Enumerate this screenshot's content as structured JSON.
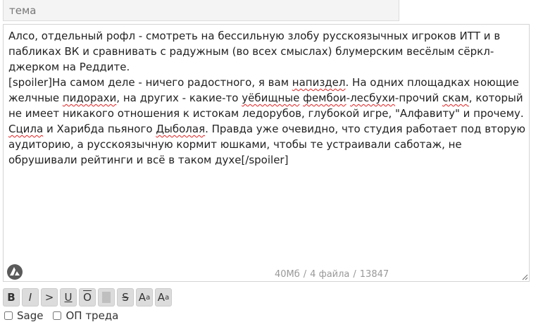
{
  "subject": {
    "placeholder": "тема",
    "value": ""
  },
  "message": {
    "segments": [
      {
        "text": "Алсо, отдельный рофл - смотреть на бессильную злобу русскоязычных игроков ИТТ и в пабликах ВК и сравнивать с радужным (во всех смыслах) блумерским весёлым сёркл-джерком на Реддите.\n[spoiler]На самом деле - ничего радостного, я вам ",
        "flag": false
      },
      {
        "text": "напиздел",
        "flag": true
      },
      {
        "text": ". На одних площадках ноющие желчные ",
        "flag": false
      },
      {
        "text": "пидорахи",
        "flag": true
      },
      {
        "text": ", на других - какие-то ",
        "flag": false
      },
      {
        "text": "уёбищные",
        "flag": true
      },
      {
        "text": " ",
        "flag": false
      },
      {
        "text": "фембои",
        "flag": true
      },
      {
        "text": "-",
        "flag": false
      },
      {
        "text": "лесбухи",
        "flag": true
      },
      {
        "text": "-прочий ",
        "flag": false
      },
      {
        "text": "скам",
        "flag": true
      },
      {
        "text": ", который не имеет никакого отношения к истокам ледорубов, глубокой игре, \"Алфавиту\" и прочему. ",
        "flag": false
      },
      {
        "text": "Сцила",
        "flag": true
      },
      {
        "text": " и Харибда пьяного ",
        "flag": false
      },
      {
        "text": "Дыболая",
        "flag": true
      },
      {
        "text": ". Правда уже очевидно, что студия работает под вторую аудиторию, а русскоязычную кормит юшками, чтобы те устраивали саботаж, не обрушивали рейтинги и всё в таком духе[/spoiler]",
        "flag": false
      }
    ]
  },
  "stats": {
    "size_limit": "40Мб",
    "files": "4 файла",
    "chars": "13847",
    "separator": "/"
  },
  "toolbar": {
    "bold": "B",
    "italic": "I",
    "quote": ">",
    "underline": "U",
    "overline": "O",
    "strike": "S",
    "sup_base": "A",
    "sup_mark": "a",
    "sub_base": "A",
    "sub_mark": "a"
  },
  "options": {
    "sage_label": "Sage",
    "op_label": "ОП треда"
  }
}
